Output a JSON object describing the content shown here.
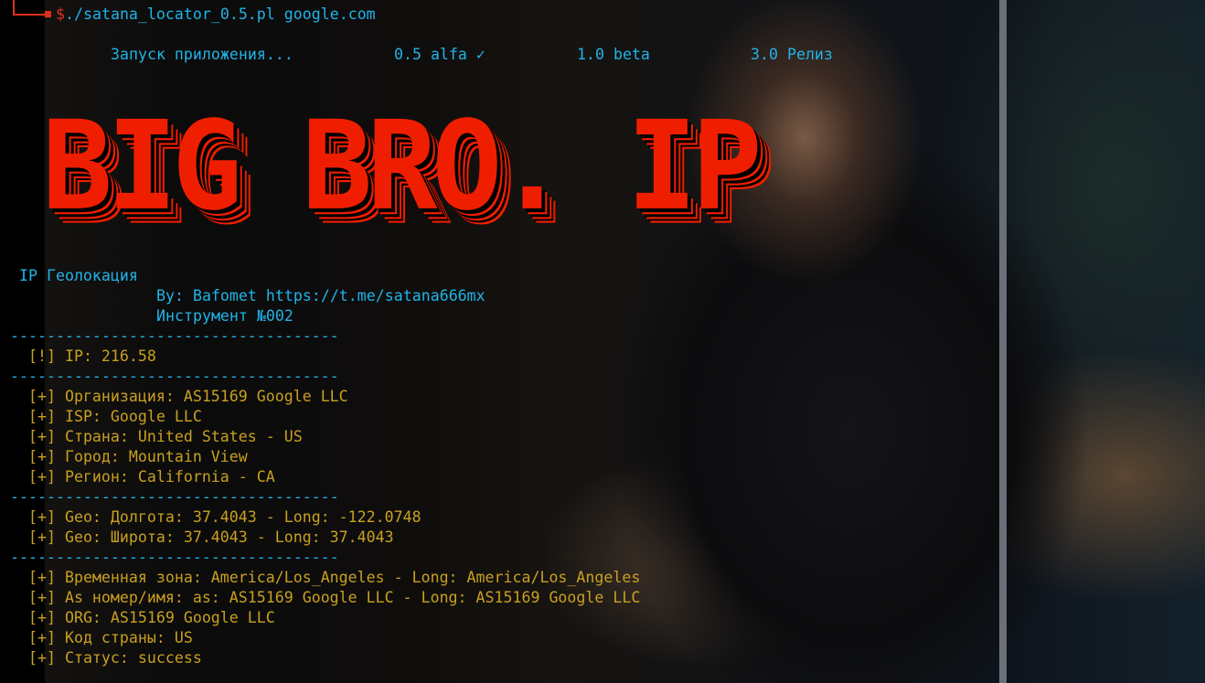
{
  "terminal": {
    "command": "$./satana_locator_0.5.pl google.com",
    "stages": [
      "Запуск приложения...",
      "0.5 alfa ✓",
      "1.0 beta",
      "3.0 Релиз"
    ],
    "banner": "BIG BRO. IP",
    "subtitle": "IP Геолокация",
    "author": "By: Bafomet https://t.me/satana666mx",
    "tool": "Инструмент №002",
    "separator": "------------------------------------",
    "ip_line": "[!] IP: 216.58",
    "block1": [
      "[+] Организация: AS15169 Google LLC",
      "[+] ISP: Google LLC",
      "[+] Страна: United States - US",
      "[+] Город: Mountain View",
      "[+] Регион: California - CA"
    ],
    "block2": [
      "[+] Geo: Долгота: 37.4043 - Long: -122.0748",
      "[+] Geo: Широта: 37.4043 - Long: 37.4043"
    ],
    "block3": [
      "[+] Временная зона: America/Los_Angeles - Long: America/Los_Angeles",
      "[+] As номер/имя: as: AS15169 Google LLC - Long: AS15169 Google LLC",
      "[+] ORG: AS15169 Google LLC",
      "[+] Код страны: US",
      "[+] Статус: success"
    ]
  },
  "colors": {
    "cyan": "#20b4e8",
    "yellow": "#c8a020",
    "red": "#f01e00"
  }
}
